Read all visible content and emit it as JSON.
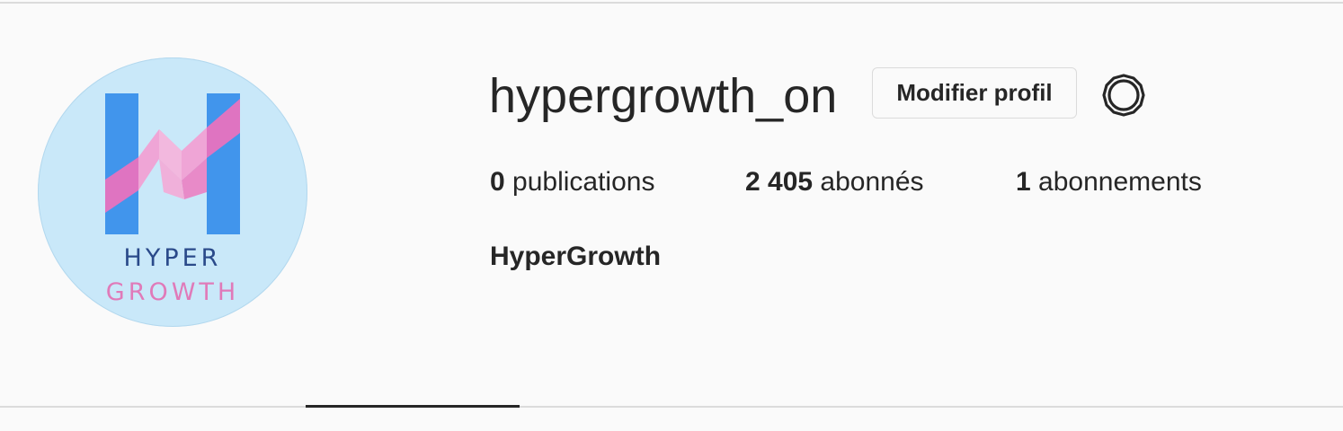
{
  "profile": {
    "username": "hypergrowth_on",
    "edit_label": "Modifier profil",
    "full_name": "HyperGrowth",
    "avatar_text": {
      "line1": "HYPER",
      "line2": "GROWTH"
    }
  },
  "stats": {
    "posts": {
      "count": "0",
      "label": "publications"
    },
    "followers": {
      "count": "2 405",
      "label": "abonnés"
    },
    "following": {
      "count": "1",
      "label": "abonnements"
    }
  },
  "icons": {
    "settings": "gear-icon"
  },
  "colors": {
    "avatar_bg": "#c9e8f9",
    "logo_blue": "#4195ec",
    "logo_pink": "#e872bf",
    "logo_text_blue": "#2a4a8a",
    "logo_text_pink": "#e07ab9",
    "text": "#262626",
    "border": "#dbdbdb"
  }
}
